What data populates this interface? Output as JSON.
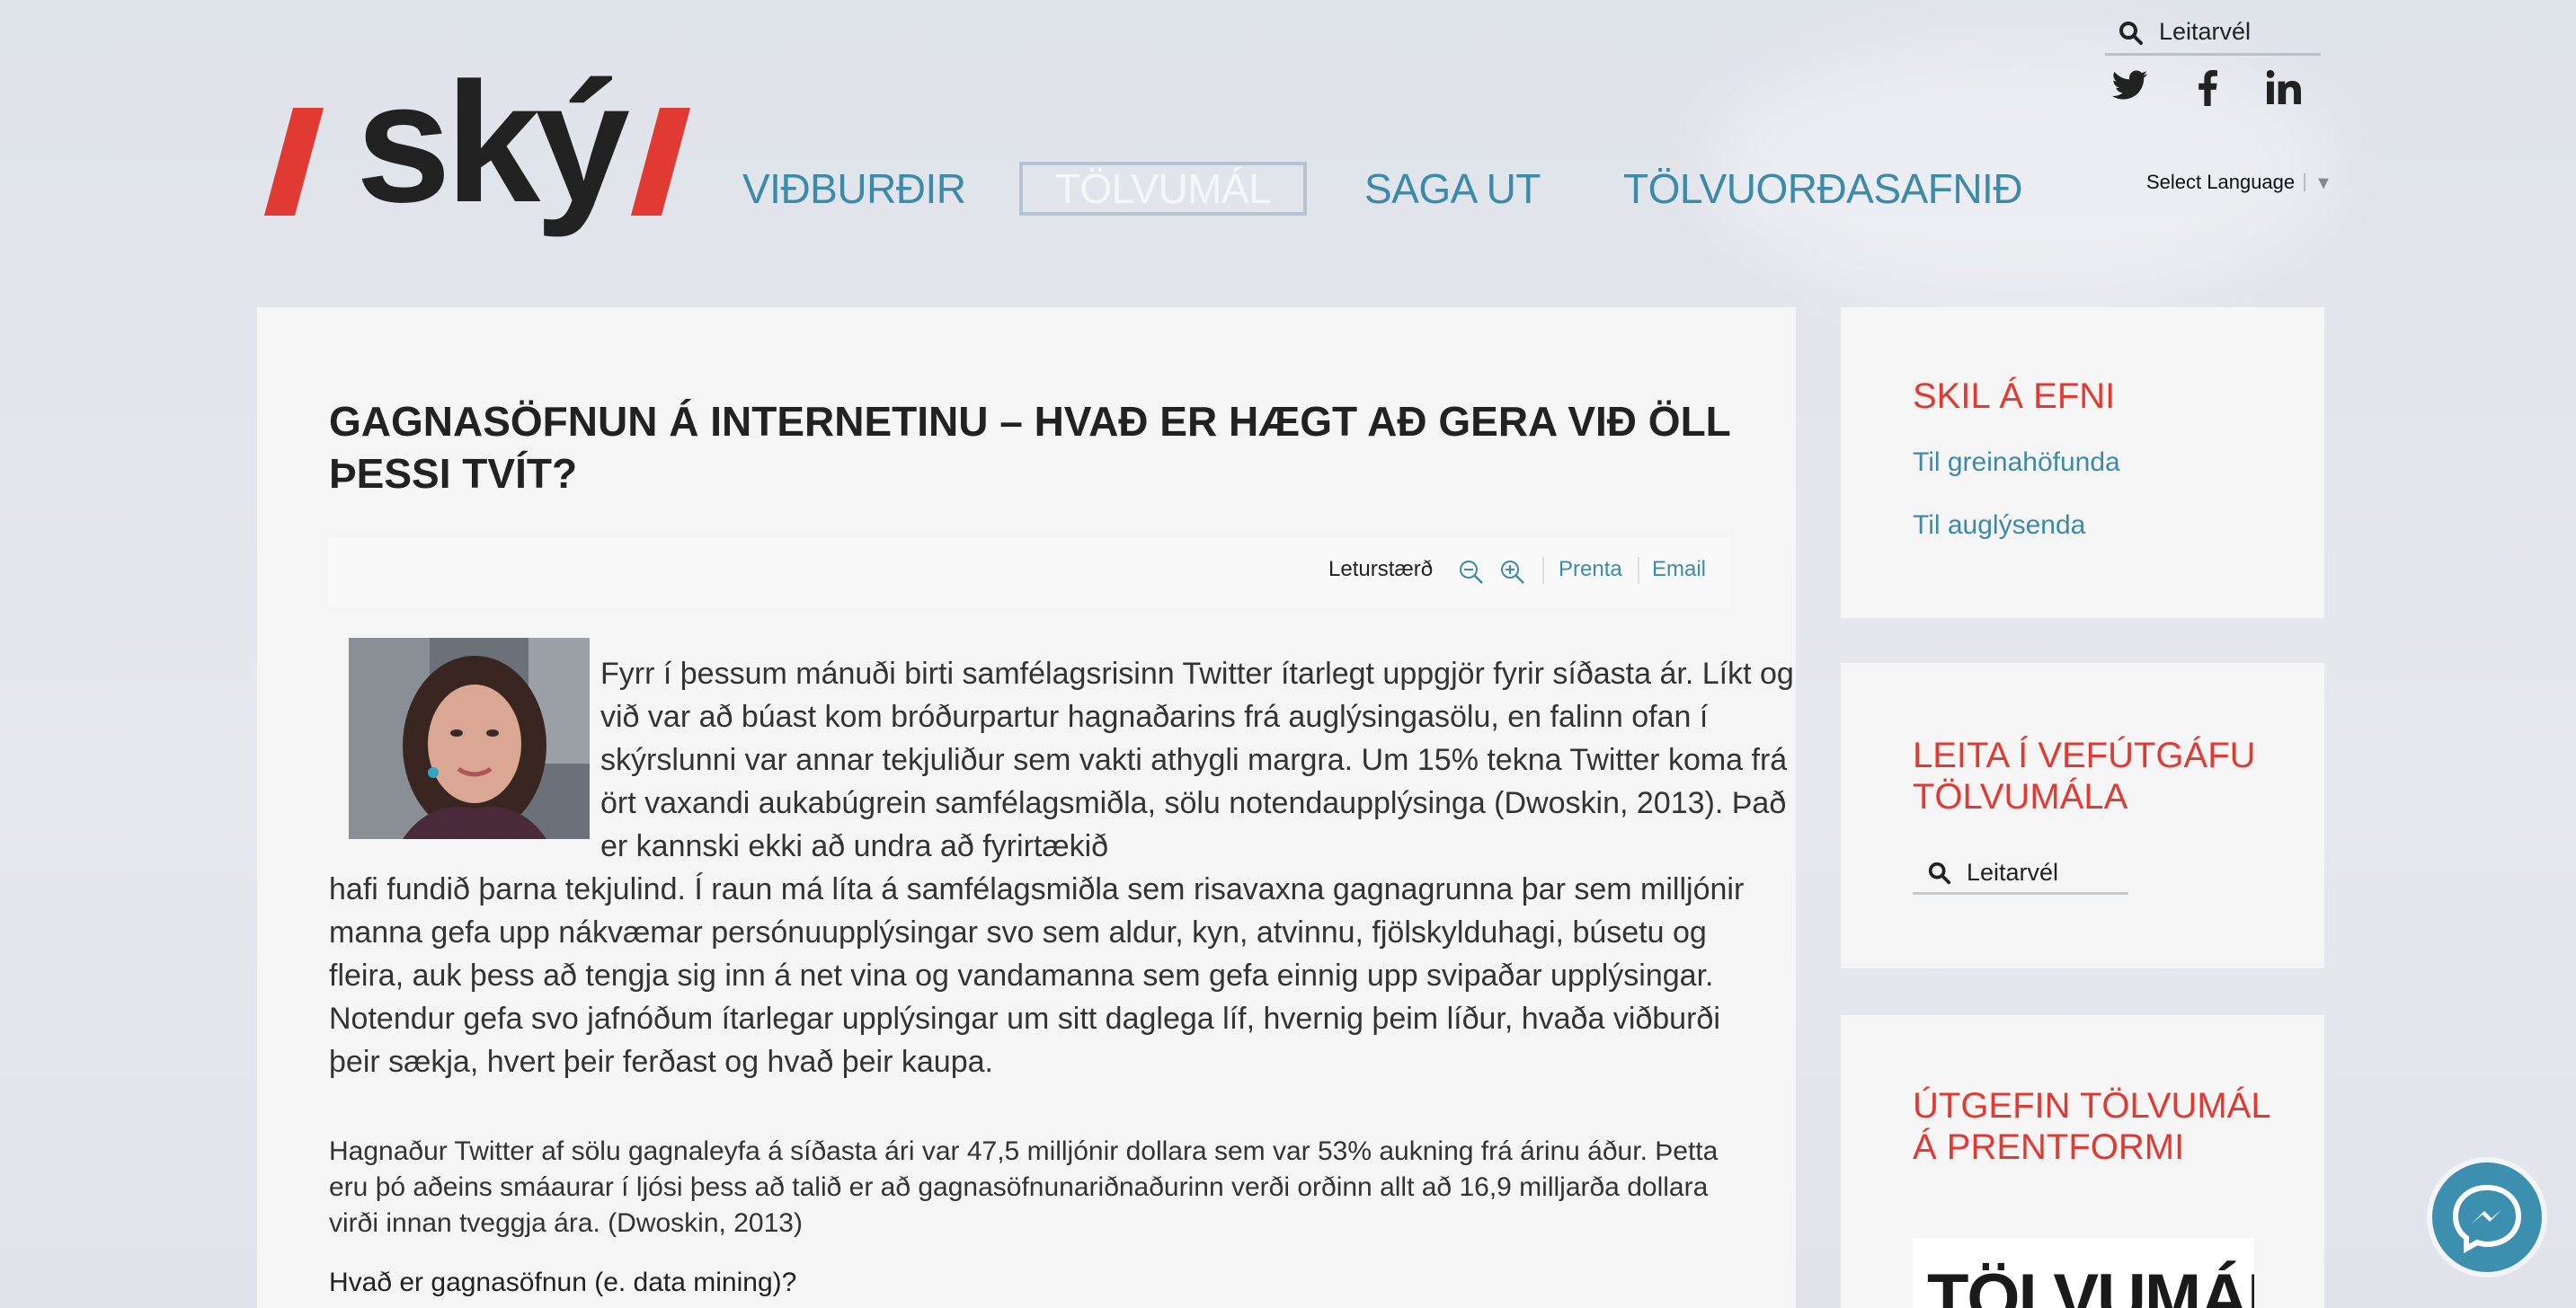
{
  "header": {
    "logo_text": "ský",
    "nav": [
      {
        "label": "VIÐBURÐIR",
        "active": false
      },
      {
        "label": "TÖLVUMÁL",
        "active": true
      },
      {
        "label": "SAGA UT",
        "active": false
      },
      {
        "label": "TÖLVUORÐASAFNIÐ",
        "active": false
      }
    ],
    "search_placeholder": "Leitarvél",
    "social": [
      "twitter-icon",
      "facebook-icon",
      "linkedin-icon"
    ],
    "language": {
      "label": "Select Language",
      "arrow": "▼"
    }
  },
  "article": {
    "title": "GAGNASÖFNUN Á INTERNETINU – HVAÐ ER HÆGT AÐ GERA VIÐ ÖLL ÞESSI TVÍT?",
    "toolbar": {
      "font_size_label": "Leturstærð",
      "print": "Prenta",
      "email": "Email"
    },
    "lead_first": "Fyrr í þessum mánuði birti samfélagsrisinn Twitter ítarlegt uppgjör fyrir síðasta ár. Líkt og við var að búast kom bróðurpartur hagnaðarins frá auglýsingasölu, en falinn ofan í skýrslunni var annar tekjuliður sem vakti athygli margra. Um 15% tekna Twitter koma frá ört vaxandi aukabúgrein samfélagsmiðla, sölu notendaupplýsinga (Dwoskin, 2013).  Það er kannski ekki að undra að fyrirtækið",
    "lead_rest": "hafi fundið þarna tekjulind. Í raun má líta á samfélagsmiðla sem risavaxna gagnagrunna þar sem milljónir manna gefa upp nákvæmar persónuupplýsingar svo sem aldur, kyn, atvinnu, fjölskylduhagi, búsetu og fleira, auk þess að tengja sig inn á net vina og vandamanna sem gefa einnig upp svipaðar upplýsingar. Notendur gefa svo jafnóðum ítarlegar upplýsingar um sitt daglega líf, hvernig þeim líður, hvaða viðburði þeir sækja, hvert þeir ferðast og hvað þeir kaupa.",
    "paragraph": "Hagnaður Twitter af sölu gagnaleyfa á síðasta ári var 47,5 milljónir dollara sem var 53% aukning frá árinu áður. Þetta eru þó aðeins smáaurar í ljósi þess að talið er að gagnasöfnunariðnaðurinn verði orðinn allt að 16,9 milljarða dollara virði innan tveggja ára. (Dwoskin, 2013)",
    "subheading": "Hvað er gagnasöfnun (e. data mining)?"
  },
  "sidebar": {
    "submit": {
      "title": "SKIL Á EFNI",
      "links": [
        "Til greinahöfunda",
        "Til auglýsenda"
      ]
    },
    "search": {
      "title": "LEITA Í VEFÚTGÁFU TÖLVUMÁLA",
      "placeholder": "Leitarvél"
    },
    "print": {
      "title": "ÚTGEFIN TÖLVUMÁL Á PRENTFORMI",
      "magazine_title": "TÖLVUMÁL"
    }
  },
  "colors": {
    "accent_red": "#e03a32",
    "link_blue": "#3c8aaa",
    "messenger": "#3d8fb0"
  }
}
